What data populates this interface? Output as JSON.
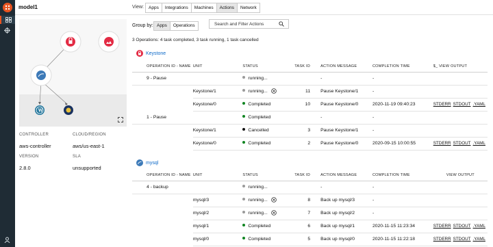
{
  "header": {
    "model_name": "model1",
    "view_label": "View:",
    "view_tabs": [
      "Apps",
      "Integrations",
      "Machines",
      "Actions",
      "Network"
    ],
    "active_tab": "Actions"
  },
  "info": {
    "controller_label": "CONTROLLER",
    "controller_value": "aws-controller",
    "cloud_label": "CLOUD/REGION",
    "cloud_value": "aws/us-east-1",
    "version_label": "VERSION",
    "version_value": "2.8.0",
    "sla_label": "SLA",
    "sla_value": "unsupported"
  },
  "toolbar": {
    "group_by_label": "Group by:",
    "group_options": [
      "Apps",
      "Operations"
    ],
    "active_group": "Apps",
    "search_placeholder": "Search and Filter Actions"
  },
  "summary": "3 Operations: 4 task completed, 3 task running, 1 task cancelled",
  "columns": {
    "keystone": [
      "OPERATION ID - NAME",
      "UNIT",
      "STATUS",
      "TASK ID",
      "ACTION MESSAGE",
      "COMPLETION TIME",
      "$_ VIEW OUTPUT"
    ],
    "mysql": [
      "OPERATION ID - NAME",
      "UNIT",
      "STATUS",
      "TASK ID",
      "ACTION MESSAGE",
      "COMPLETION TIME",
      "VIEW OUTPUT"
    ]
  },
  "output_links": [
    "STDERR",
    "STDOUT",
    ".YAML"
  ],
  "colors": {
    "accent": "#e95420",
    "link": "#0b68c8",
    "completed": "#0e8420",
    "running": "#9a9a9a"
  },
  "apps": [
    {
      "name": "Keystone",
      "rows": [
        {
          "op": "9 - Pause",
          "unit": "",
          "status": "running...",
          "state": "running",
          "task": "",
          "message": "-",
          "time": "-",
          "links": false,
          "cancel": false
        },
        {
          "op": "",
          "unit": "Keystone/1",
          "status": "running...",
          "state": "running",
          "task": "11",
          "message": "Pause Keystone/1",
          "time": "-",
          "links": false,
          "cancel": true
        },
        {
          "op": "",
          "unit": "Keystone/0",
          "status": "Completed",
          "state": "completed",
          "task": "10",
          "message": "Pause Keystone/0",
          "time": "2020-11-19 09:40:23",
          "links": true,
          "cancel": false
        },
        {
          "op": "1 - Pause",
          "unit": "",
          "status": "Completed",
          "state": "completed",
          "task": "",
          "message": "-",
          "time": "-",
          "links": false,
          "cancel": false
        },
        {
          "op": "",
          "unit": "Keystone/1",
          "status": "Cancelled",
          "state": "cancelled",
          "task": "3",
          "message": "Pause Keystone/1",
          "time": "-",
          "links": false,
          "cancel": false
        },
        {
          "op": "",
          "unit": "Keystone/0",
          "status": "Completed",
          "state": "completed",
          "task": "2",
          "message": "Pause Keystone/0",
          "time": "2020-09-15 10:00:55",
          "links": true,
          "cancel": false
        }
      ]
    },
    {
      "name": "mysql",
      "rows": [
        {
          "op": "4 - backup",
          "unit": "",
          "status": "running...",
          "state": "running",
          "task": "",
          "message": "-",
          "time": "-",
          "links": false,
          "cancel": false
        },
        {
          "op": "",
          "unit": "mysql/3",
          "status": "running...",
          "state": "running",
          "task": "8",
          "message": "Back up mysql/3",
          "time": "-",
          "links": false,
          "cancel": true
        },
        {
          "op": "",
          "unit": "mysql/2",
          "status": "running...",
          "state": "running",
          "task": "7",
          "message": "Back up mysql/2",
          "time": "-",
          "links": false,
          "cancel": true
        },
        {
          "op": "",
          "unit": "mysql/1",
          "status": "Completed",
          "state": "completed",
          "task": "6",
          "message": "Back up mysql/1",
          "time": "2020-11-15 11:23:34",
          "links": true,
          "cancel": false
        },
        {
          "op": "",
          "unit": "mysql/0",
          "status": "Completed",
          "state": "completed",
          "task": "5",
          "message": "Back up mysql/0",
          "time": "2020-11-15 11:22:18",
          "links": true,
          "cancel": false
        }
      ]
    }
  ]
}
